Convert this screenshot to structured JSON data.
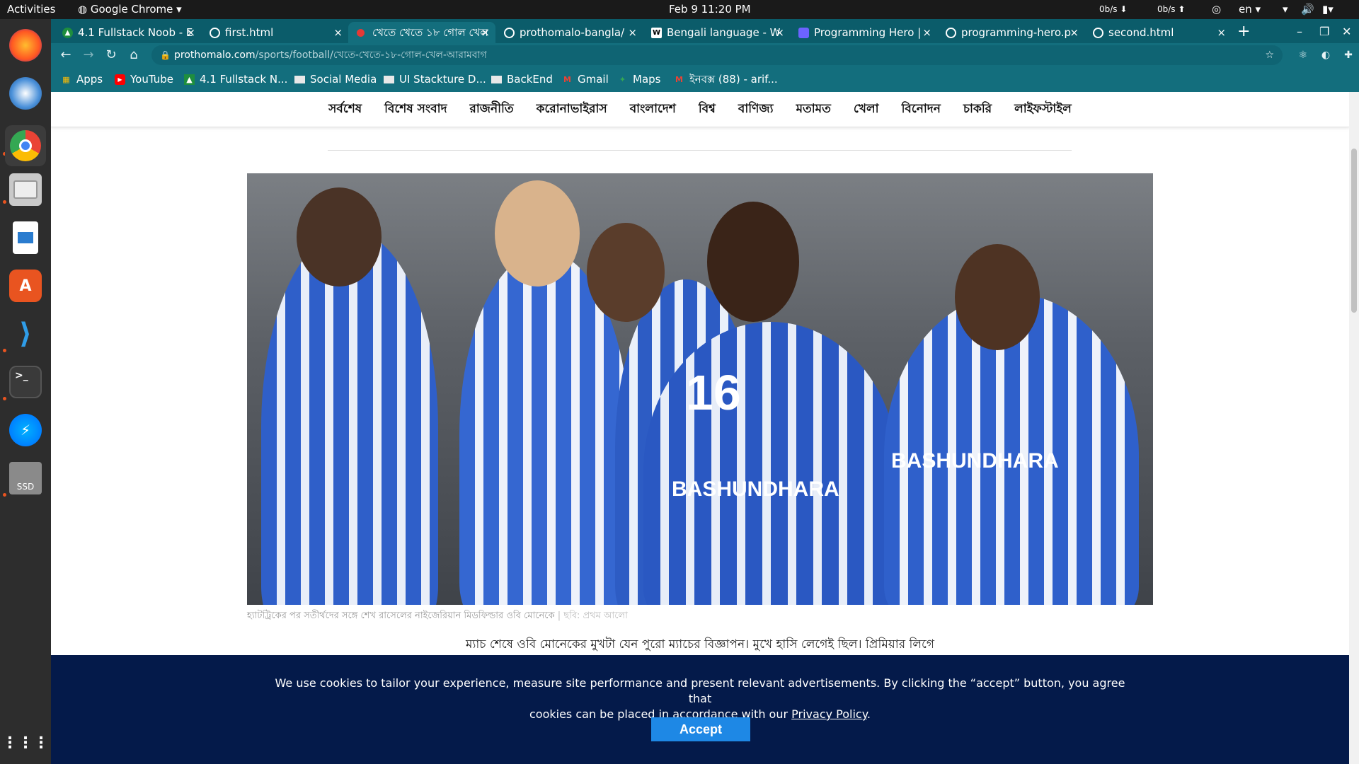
{
  "system": {
    "activities": "Activities",
    "app_name": "Google Chrome",
    "clock": "Feb 9  11:20 PM",
    "net_down": "0b/s",
    "net_up": "0b/s",
    "lang": "en"
  },
  "dock": {
    "apps": [
      "firefox-icon",
      "thunderbird-icon",
      "chrome-icon",
      "files-icon",
      "writer-icon",
      "software-icon",
      "vscode-icon",
      "terminal-icon",
      "messenger-icon",
      "ssd-drive-icon"
    ],
    "ssd_label": "SSD",
    "grid_label": "⋮⋮⋮"
  },
  "tabs": [
    {
      "title": "4.1 Fullstack Noob - E"
    },
    {
      "title": "first.html"
    },
    {
      "title": "খেতে খেতে ১৮ গোল খেল"
    },
    {
      "title": "prothomalo-bangla/"
    },
    {
      "title": "Bengali language - W"
    },
    {
      "title": "Programming Hero |"
    },
    {
      "title": "programming-hero.p"
    },
    {
      "title": "second.html"
    }
  ],
  "url": {
    "host": "prothomalo.com",
    "path": "/sports/football/খেতে-খেতে-১৮-গোল-খেল-আরামবাগ"
  },
  "bookmarks": [
    "Apps",
    "YouTube",
    "4.1 Fullstack N...",
    "Social Media",
    "UI Stackture D...",
    "BackEnd",
    "Gmail",
    "Maps",
    "ইনবক্স (88) - arif..."
  ],
  "nav": [
    "সর্বশেষ",
    "বিশেষ সংবাদ",
    "রাজনীতি",
    "করোনাভাইরাস",
    "বাংলাদেশ",
    "বিশ্ব",
    "বাণিজ্য",
    "মতামত",
    "খেলা",
    "বিনোদন",
    "চাকরি",
    "লাইফস্টাইল"
  ],
  "article": {
    "caption": "হ্যাটট্রিকের পর সতীর্থদের সঙ্গে শেখ রাসেলের নাইজেরিয়ান মিডফিল্ডার ওবি মোনেকে",
    "credit": "ছবি: প্রথম আলো",
    "lede": "ম্যাচ শেষে ওবি মোনেকের মুখটা যেন পুরো ম্যাচের বিজ্ঞাপন। মুখে হাসি লেগেই ছিল। প্রিমিয়ার লিগে",
    "jersey_number": "16",
    "jersey_text": "BASHUNDHARA"
  },
  "cookie": {
    "text_line1": "We use cookies to tailor your experience, measure site performance and present relevant advertisements. By clicking the “accept” button, you agree that",
    "text_line2_pre": "cookies can be placed in accordance with our ",
    "privacy_link": "Privacy Policy",
    "text_line2_post": ".",
    "accept": "Accept"
  }
}
